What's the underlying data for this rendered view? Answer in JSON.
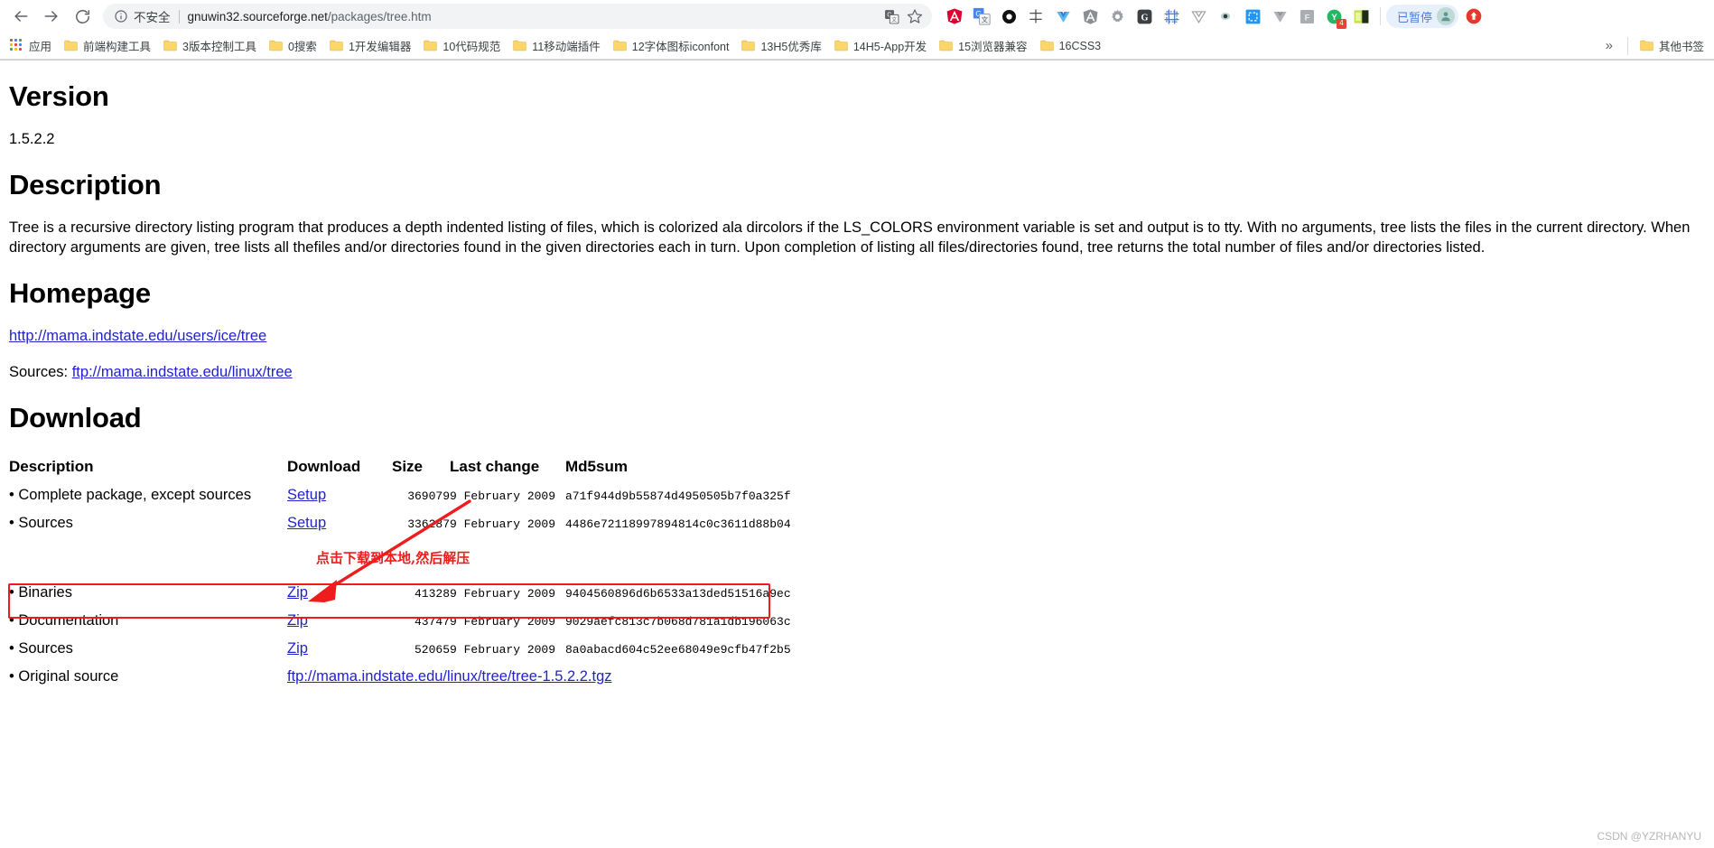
{
  "browser": {
    "nav": {
      "back_icon": "arrow-left-icon",
      "forward_icon": "arrow-right-icon",
      "reload_icon": "reload-icon"
    },
    "omnibox": {
      "info_icon": "info-circle-icon",
      "security_label": "不安全",
      "url_host": "gnuwin32.sourceforge.net",
      "url_path": "/packages/tree.htm",
      "translate_icon": "translate-icon",
      "bookmark_star_icon": "star-icon"
    },
    "extensions": [
      {
        "name": "angular-extension-icon",
        "glyph": "A"
      },
      {
        "name": "google-translate-extension-icon",
        "glyph": "G"
      },
      {
        "name": "black-ring-extension-icon",
        "glyph": "O"
      },
      {
        "name": "crosshair-extension-icon",
        "glyph": "+"
      },
      {
        "name": "vue-devtools-extension-icon",
        "glyph": "V"
      },
      {
        "name": "angular-grey-extension-icon",
        "glyph": "A"
      },
      {
        "name": "gear-extension-icon",
        "glyph": "*"
      },
      {
        "name": "g-letter-extension-icon",
        "glyph": "G"
      },
      {
        "name": "crop-frame-extension-icon",
        "glyph": "#"
      },
      {
        "name": "vue-outline-extension-icon",
        "glyph": "V"
      },
      {
        "name": "eye-extension-icon",
        "glyph": "o"
      },
      {
        "name": "screenshot-extension-icon",
        "glyph": "[]"
      },
      {
        "name": "vuejs-grey-extension-icon",
        "glyph": "V"
      },
      {
        "name": "f-letter-extension-icon",
        "glyph": "F"
      },
      {
        "name": "youdao-extension-icon",
        "glyph": "Y",
        "badge": "4"
      },
      {
        "name": "green-window-extension-icon",
        "glyph": ""
      }
    ],
    "profile": {
      "paused_label": "已暂停",
      "avatar_icon": "user-avatar-icon"
    },
    "menu_icon": "chrome-menu-icon"
  },
  "bookmarks": {
    "apps_label": "应用",
    "apps_icon": "apps-grid-icon",
    "folders": [
      "前端构建工具",
      "3版本控制工具",
      "0搜索",
      "1开发编辑器",
      "10代码规范",
      "11移动端插件",
      "12字体图标iconfont",
      "13H5优秀库",
      "14H5-App开发",
      "15浏览器兼容",
      "16CSS3"
    ],
    "overflow_icon": "chevron-double-right-icon",
    "other_bookmarks_label": "其他书签",
    "other_bookmarks_icon": "folder-icon"
  },
  "page": {
    "version": {
      "heading": "Version",
      "value": "1.5.2.2"
    },
    "description": {
      "heading": "Description",
      "text": "Tree is a recursive directory listing program that produces a depth indented listing of files, which is colorized ala dircolors if the LS_COLORS environment variable is set and output is to tty. With no arguments, tree lists the files in the current directory. When directory arguments are given, tree lists all thefiles and/or directories found in the given directories each in turn. Upon completion of listing all files/directories found, tree returns the total number of files and/or directories listed."
    },
    "homepage": {
      "heading": "Homepage",
      "link": "http://mama.indstate.edu/users/ice/tree",
      "sources_label": "Sources:",
      "sources_link": "ftp://mama.indstate.edu/linux/tree"
    },
    "download": {
      "heading": "Download",
      "columns": [
        "Description",
        "Download",
        "Size",
        "Last change",
        "Md5sum"
      ],
      "rows": [
        {
          "description": "• Complete package, except sources",
          "download_label": "Setup",
          "size": "369079",
          "last_change": "9 February 2009",
          "md5sum": "a71f944d9b55874d4950505b7f0a325f"
        },
        {
          "description": "• Sources",
          "download_label": "Setup",
          "size": "336287",
          "last_change": "9 February 2009",
          "md5sum": "4486e72118997894814c0c3611d88b04"
        },
        {
          "description": "• Binaries",
          "download_label": "Zip",
          "size": "41328",
          "last_change": "9 February 2009",
          "md5sum": "9404560896d6b6533a13ded51516a9ec"
        },
        {
          "description": "• Documentation",
          "download_label": "Zip",
          "size": "43747",
          "last_change": "9 February 2009",
          "md5sum": "9029aefc813c7b068d781a1db196063c"
        },
        {
          "description": "• Sources",
          "download_label": "Zip",
          "size": "52065",
          "last_change": "9 February 2009",
          "md5sum": "8a0abacd604c52ee68049e9cfb47f2b5"
        },
        {
          "description": "• Original source",
          "download_label": "ftp://mama.indstate.edu/linux/tree/tree-1.5.2.2.tgz",
          "size": "",
          "last_change": "",
          "md5sum": ""
        }
      ]
    }
  },
  "annotations": {
    "note_text": "点击下载到本地,然后解压",
    "highlight_color": "#ee1c1c"
  },
  "watermark": "CSDN @YZRHANYU"
}
